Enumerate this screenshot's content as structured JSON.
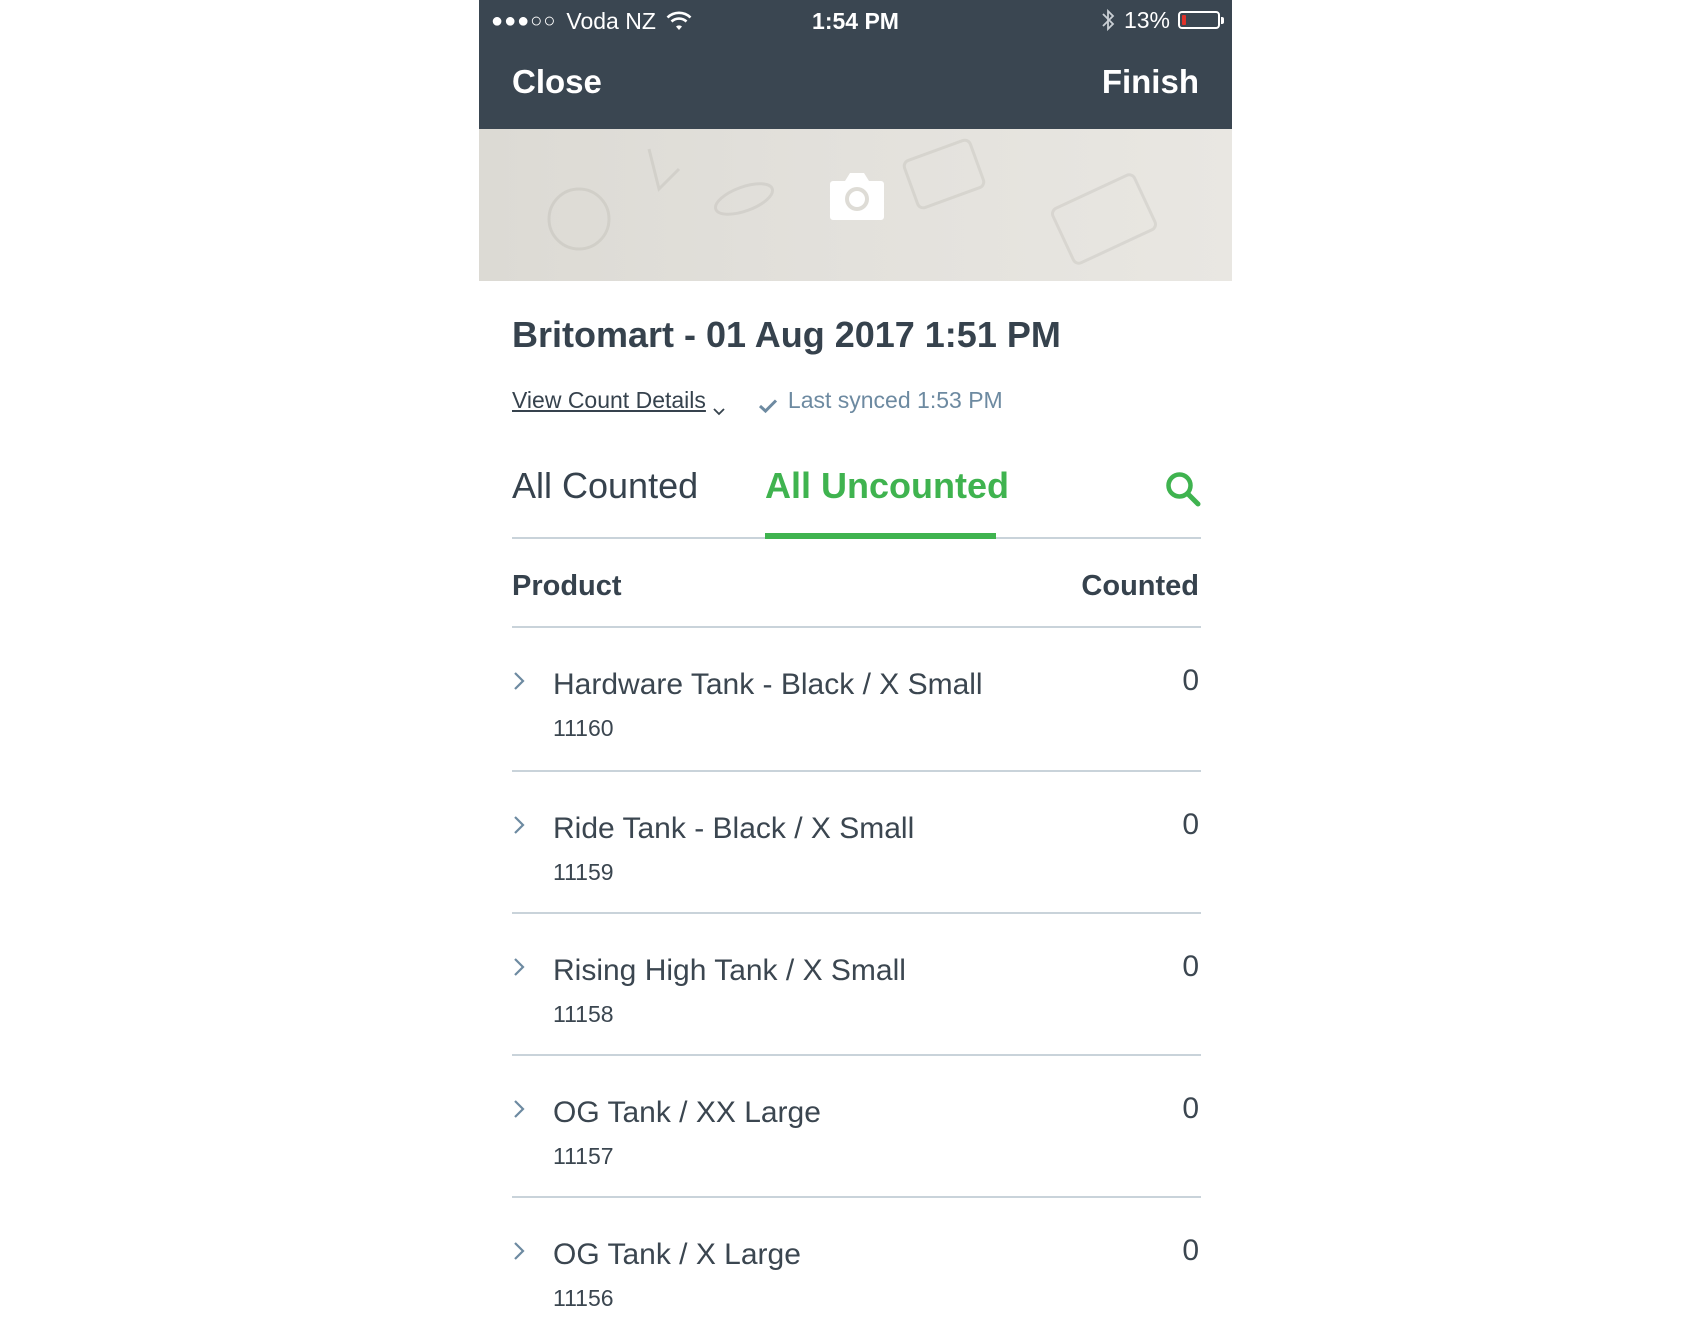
{
  "status_bar": {
    "signal": "●●●○○",
    "carrier": "Voda NZ",
    "time": "1:54 PM",
    "battery": "13%",
    "battery_level": 0.13,
    "battery_color": "#e0322a"
  },
  "nav": {
    "close_label": "Close",
    "finish_label": "Finish"
  },
  "photo": {
    "icon": "camera-icon"
  },
  "count": {
    "title": "Britomart - 01 Aug 2017 1:51 PM",
    "view_details_label": "View Count Details",
    "sync_status": "Last synced 1:53 PM"
  },
  "tabs": {
    "items": [
      {
        "label": "All Counted",
        "active": false
      },
      {
        "label": "All Uncounted",
        "active": true
      }
    ],
    "active_color": "#3fb34f"
  },
  "table": {
    "headers": {
      "product": "Product",
      "counted": "Counted"
    },
    "rows": [
      {
        "name": "Hardware Tank - Black / X Small",
        "sku": "11160",
        "counted": "0"
      },
      {
        "name": "Ride Tank - Black / X Small",
        "sku": "11159",
        "counted": "0"
      },
      {
        "name": "Rising High Tank / X Small",
        "sku": "11158",
        "counted": "0"
      },
      {
        "name": "OG Tank / XX Large",
        "sku": "11157",
        "counted": "0"
      },
      {
        "name": "OG Tank / X Large",
        "sku": "11156",
        "counted": "0"
      }
    ]
  },
  "colors": {
    "header_bg": "#3a4651",
    "text": "#36424d",
    "accent": "#3fb34f",
    "sync_text": "#6d8aa1",
    "divider": "#c9d3da"
  }
}
